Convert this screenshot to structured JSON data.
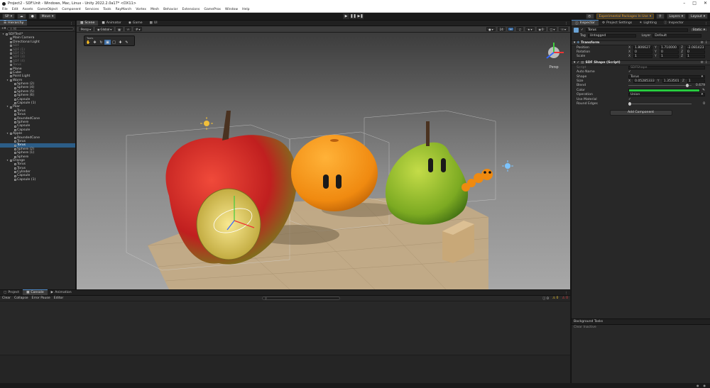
{
  "title_bar": {
    "text": "Project2 - SDF.Unit - Windows, Mac, Linux - Unity 2022.2.0a17* <DX11>"
  },
  "menu": [
    "File",
    "Edit",
    "Assets",
    "GameObject",
    "Component",
    "Services",
    "Tools",
    "RayMarch",
    "Vortex",
    "Mesh",
    "Behavior",
    "Extensions",
    "GameProx",
    "Window",
    "Help"
  ],
  "toolbar": {
    "account": "SP",
    "cloud": "",
    "mode": "Move",
    "experimental": "Experimental Packages In Use",
    "layers": "Layers",
    "layout": "Layout"
  },
  "hierarchy": {
    "tab": "Hierarchy",
    "search_placeholder": "All",
    "items": [
      {
        "label": "SDFTest*",
        "depth": 0,
        "state": "root"
      },
      {
        "label": "Main Camera",
        "depth": 1,
        "state": "normal"
      },
      {
        "label": "Directional Light",
        "depth": 1,
        "state": "normal"
      },
      {
        "label": "SDF",
        "depth": 1,
        "state": "dim"
      },
      {
        "label": "SDF (1)",
        "depth": 1,
        "state": "dim"
      },
      {
        "label": "SDF (2)",
        "depth": 1,
        "state": "dim"
      },
      {
        "label": "SDF (3)",
        "depth": 1,
        "state": "dim"
      },
      {
        "label": "SDF (4)",
        "depth": 1,
        "state": "dim"
      },
      {
        "label": "Torus",
        "depth": 1,
        "state": "dim"
      },
      {
        "label": "Plane",
        "depth": 1,
        "state": "normal"
      },
      {
        "label": "Cube",
        "depth": 1,
        "state": "normal"
      },
      {
        "label": "Point Light",
        "depth": 1,
        "state": "normal"
      },
      {
        "label": "Worm",
        "depth": 1,
        "state": "normal"
      },
      {
        "label": "Sphere (2)",
        "depth": 2,
        "state": "normal"
      },
      {
        "label": "Sphere (4)",
        "depth": 2,
        "state": "normal"
      },
      {
        "label": "Sphere (5)",
        "depth": 2,
        "state": "normal"
      },
      {
        "label": "Sphere (6)",
        "depth": 2,
        "state": "normal"
      },
      {
        "label": "Capsule",
        "depth": 2,
        "state": "normal"
      },
      {
        "label": "Capsule (1)",
        "depth": 2,
        "state": "normal"
      },
      {
        "label": "Pear",
        "depth": 1,
        "state": "normal"
      },
      {
        "label": "Torus",
        "depth": 2,
        "state": "normal"
      },
      {
        "label": "Torus",
        "depth": 2,
        "state": "normal"
      },
      {
        "label": "RoundedCone",
        "depth": 2,
        "state": "normal"
      },
      {
        "label": "Sphere",
        "depth": 2,
        "state": "normal"
      },
      {
        "label": "Capsule",
        "depth": 2,
        "state": "normal"
      },
      {
        "label": "Capsule",
        "depth": 2,
        "state": "normal"
      },
      {
        "label": "Apple",
        "depth": 1,
        "state": "normal"
      },
      {
        "label": "RoundedCone",
        "depth": 2,
        "state": "normal"
      },
      {
        "label": "Torus",
        "depth": 2,
        "state": "normal"
      },
      {
        "label": "Torus",
        "depth": 2,
        "state": "selected"
      },
      {
        "label": "Sphere (2)",
        "depth": 2,
        "state": "normal"
      },
      {
        "label": "Sphere (1)",
        "depth": 2,
        "state": "normal"
      },
      {
        "label": "Sphere",
        "depth": 2,
        "state": "normal"
      },
      {
        "label": "Orange",
        "depth": 1,
        "state": "normal"
      },
      {
        "label": "Torus",
        "depth": 2,
        "state": "normal"
      },
      {
        "label": "Torus",
        "depth": 2,
        "state": "normal"
      },
      {
        "label": "Cylinder",
        "depth": 2,
        "state": "normal"
      },
      {
        "label": "Capsule",
        "depth": 2,
        "state": "normal"
      },
      {
        "label": "Capsule (1)",
        "depth": 2,
        "state": "normal"
      }
    ]
  },
  "scene": {
    "tabs": [
      "Scene",
      "Animator",
      "Game",
      "UI"
    ],
    "shading": "Persp",
    "pivot": "Global",
    "gizmo_label": "Persp",
    "count": "24",
    "tools_title": "Tools"
  },
  "inspector": {
    "tabs": [
      "Inspector",
      "Project Settings",
      "Lighting",
      "Inspector"
    ],
    "object_name": "Torus",
    "static": "Static",
    "tag_label": "Tag",
    "tag": "Untagged",
    "layer_label": "Layer",
    "layer": "Default",
    "transform": {
      "title": "Transform",
      "rows": [
        {
          "label": "Position",
          "x": "1.806627",
          "y": "1.710000",
          "z": "-2.081423"
        },
        {
          "label": "Rotation",
          "x": "0",
          "y": "0",
          "z": "0"
        },
        {
          "label": "Scale",
          "x": "1",
          "y": "1",
          "z": "1"
        }
      ]
    },
    "sdf": {
      "title": "SDF Shape (Script)",
      "script_label": "Script",
      "script": "SDFShape",
      "auto_name_label": "Auto Name",
      "shape_label": "Shape",
      "shape": "Torus",
      "size_label": "Size",
      "size_x": "0.05285333",
      "size_y": "1.353501",
      "size_z": "1",
      "blend_label": "Blend",
      "blend": "0.679",
      "blend_fraction": 0.93,
      "color_label": "Color",
      "color_hex": "#27c93f",
      "operation_label": "Operation",
      "operation": "Union",
      "use_material_label": "Use Material",
      "round_edges_label": "Round Edges",
      "round_edges": "0",
      "round_fraction": 0.0
    },
    "add_component": "Add Component"
  },
  "console": {
    "tabs": [
      "Project",
      "Console",
      "Animation"
    ],
    "toolbar": [
      "Clear",
      "Collapse",
      "Error Pause",
      "Editor"
    ],
    "counts": [
      "0",
      "0",
      "0"
    ]
  },
  "background_tasks": {
    "title": "Background Tasks",
    "item": "Clear Inactive"
  },
  "taskbar": {
    "items": [
      "",
      ""
    ]
  }
}
